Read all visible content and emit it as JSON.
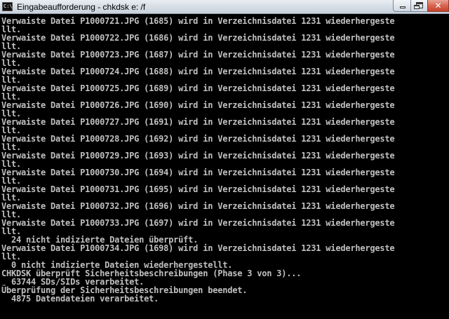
{
  "window": {
    "icon_text": "C:\\",
    "title": "Eingabeaufforderung - chkdsk  e: /f",
    "minimize_icon": "minimize-icon",
    "maximize_icon": "restore-icon",
    "close_icon": "close-icon",
    "close_glyph": "✕"
  },
  "console": {
    "lines": [
      "Verwaiste Datei P1000721.JPG (1685) wird in Verzeichnisdatei 1231 wiederhergeste",
      "llt.",
      "Verwaiste Datei P1000722.JPG (1686) wird in Verzeichnisdatei 1231 wiederhergeste",
      "llt.",
      "Verwaiste Datei P1000723.JPG (1687) wird in Verzeichnisdatei 1231 wiederhergeste",
      "llt.",
      "Verwaiste Datei P1000724.JPG (1688) wird in Verzeichnisdatei 1231 wiederhergeste",
      "llt.",
      "Verwaiste Datei P1000725.JPG (1689) wird in Verzeichnisdatei 1231 wiederhergeste",
      "llt.",
      "Verwaiste Datei P1000726.JPG (1690) wird in Verzeichnisdatei 1231 wiederhergeste",
      "llt.",
      "Verwaiste Datei P1000727.JPG (1691) wird in Verzeichnisdatei 1231 wiederhergeste",
      "llt.",
      "Verwaiste Datei P1000728.JPG (1692) wird in Verzeichnisdatei 1231 wiederhergeste",
      "llt.",
      "Verwaiste Datei P1000729.JPG (1693) wird in Verzeichnisdatei 1231 wiederhergeste",
      "llt.",
      "Verwaiste Datei P1000730.JPG (1694) wird in Verzeichnisdatei 1231 wiederhergeste",
      "llt.",
      "Verwaiste Datei P1000731.JPG (1695) wird in Verzeichnisdatei 1231 wiederhergeste",
      "llt.",
      "Verwaiste Datei P1000732.JPG (1696) wird in Verzeichnisdatei 1231 wiederhergeste",
      "llt.",
      "Verwaiste Datei P1000733.JPG (1697) wird in Verzeichnisdatei 1231 wiederhergeste",
      "llt.",
      "  24 nicht indizierte Dateien überprüft.",
      "Verwaiste Datei P1000734.JPG (1698) wird in Verzeichnisdatei 1231 wiederhergeste",
      "llt.",
      "  0 nicht indizierte Dateien wiederhergestellt.",
      "CHKDSK überprüft Sicherheitsbeschreibungen (Phase 3 von 3)...",
      "  63744 SDs/SIDs verarbeitet.",
      "Überprüfung der Sicherheitsbeschreibungen beendet.",
      "  4875 Datendateien verarbeitet."
    ]
  }
}
